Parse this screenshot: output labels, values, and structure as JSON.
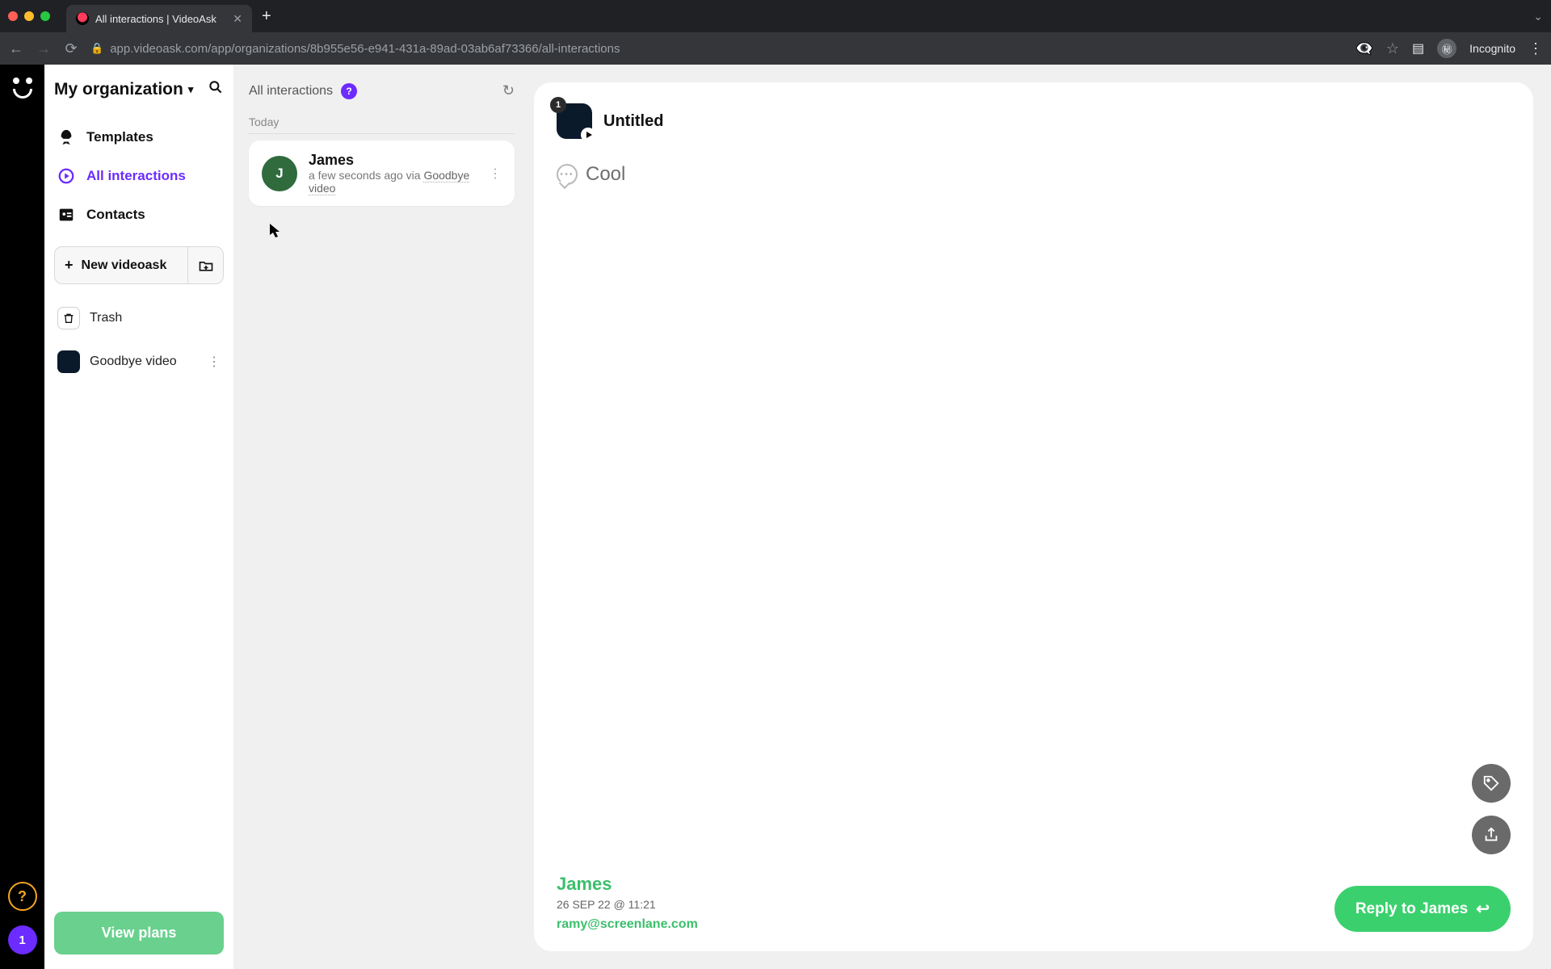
{
  "browser": {
    "tab_title": "All interactions | VideoAsk",
    "url": "app.videoask.com/app/organizations/8b955e56-e941-431a-89ad-03ab6af73366/all-interactions",
    "incognito_label": "Incognito"
  },
  "rail": {
    "help_label": "?",
    "notif_count": "1"
  },
  "sidebar": {
    "org_name": "My organization",
    "nav": {
      "templates": "Templates",
      "all_interactions": "All interactions",
      "contacts": "Contacts"
    },
    "new_button": "New videoask",
    "trash": "Trash",
    "items": [
      {
        "label": "Goodbye video"
      }
    ],
    "view_plans": "View plans"
  },
  "mid": {
    "title": "All interactions",
    "day_label": "Today",
    "card": {
      "avatar_initial": "J",
      "name": "James",
      "time": "a few seconds ago",
      "via": " via ",
      "source": "Goodbye video"
    }
  },
  "detail": {
    "badge": "1",
    "title": "Untitled",
    "message": "Cool",
    "contact_name": "James",
    "contact_date": "26 SEP 22 @ 11:21",
    "contact_email": "ramy@screenlane.com",
    "reply_label": "Reply to James"
  }
}
